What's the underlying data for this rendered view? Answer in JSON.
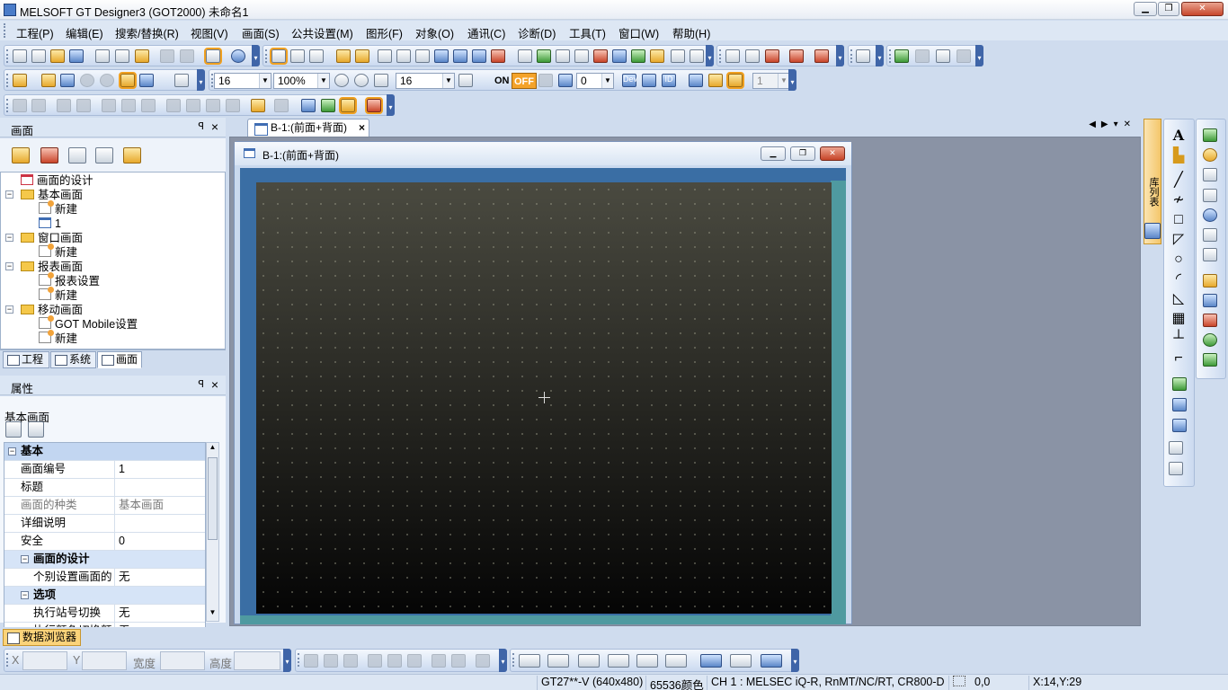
{
  "window": {
    "title": "MELSOFT GT Designer3 (GOT2000) 未命名1"
  },
  "menu": [
    "工程(P)",
    "编辑(E)",
    "搜索/替换(R)",
    "视图(V)",
    "画面(S)",
    "公共设置(M)",
    "图形(F)",
    "对象(O)",
    "通讯(C)",
    "诊断(D)",
    "工具(T)",
    "窗口(W)",
    "帮助(H)"
  ],
  "toolbar2": {
    "font_size": "16",
    "zoom": "100%",
    "grid_size": "16",
    "on_label": "ON",
    "off_label": "OFF",
    "state_value": "0",
    "dev_label": "Dev",
    "id_label": "ID",
    "layer_value": "1"
  },
  "screen_panel": {
    "title": "画面",
    "tree": [
      {
        "label": "画面的设计",
        "type": "design"
      },
      {
        "label": "基本画面",
        "type": "folder"
      },
      {
        "label": "新建",
        "type": "new"
      },
      {
        "label": "1",
        "type": "page"
      },
      {
        "label": "窗口画面",
        "type": "folder"
      },
      {
        "label": "新建",
        "type": "new"
      },
      {
        "label": "报表画面",
        "type": "folder"
      },
      {
        "label": "报表设置",
        "type": "setting"
      },
      {
        "label": "新建",
        "type": "new"
      },
      {
        "label": "移动画面",
        "type": "folder"
      },
      {
        "label": "GOT Mobile设置",
        "type": "setting"
      },
      {
        "label": "新建",
        "type": "new"
      }
    ],
    "tabs": [
      "工程",
      "系统",
      "画面"
    ],
    "active_tab": "画面"
  },
  "properties": {
    "title": "属性",
    "object_name": "基本画面",
    "rows": [
      {
        "kind": "cat",
        "k": "基本",
        "v": ""
      },
      {
        "kind": "row",
        "k": "画面编号",
        "v": "1"
      },
      {
        "kind": "row",
        "k": "标题",
        "v": ""
      },
      {
        "kind": "gray",
        "k": "画面的种类",
        "v": "基本画面"
      },
      {
        "kind": "row",
        "k": "详细说明",
        "v": ""
      },
      {
        "kind": "row",
        "k": "安全",
        "v": "0"
      },
      {
        "kind": "sub",
        "k": "画面的设计",
        "v": ""
      },
      {
        "kind": "row",
        "k": "个别设置画面的",
        "v": "无"
      },
      {
        "kind": "sub",
        "k": "选项",
        "v": ""
      },
      {
        "kind": "row",
        "k": "执行站号切换",
        "v": "无"
      },
      {
        "kind": "row",
        "k": "执行颜色切换颜",
        "v": "无"
      }
    ]
  },
  "document": {
    "tab_label": "B-1:(前面+背面)",
    "child_title": "B-1:(前面+背面)"
  },
  "right_panel": {
    "vertical_tab": "库列表"
  },
  "bottom": {
    "data_browser_tab": "数据浏览器",
    "x_label": "X",
    "y_label": "Y",
    "width_label": "宽度",
    "height_label": "高度"
  },
  "status": {
    "model": "GT27**-V (640x480)",
    "colors": "65536颜色",
    "channel": "CH 1 : MELSEC iQ-R, RnMT/NC/RT, CR800-D",
    "origin": "0,0",
    "cursor": "X:14,Y:29"
  },
  "colors": {
    "accent": "#3f65a8",
    "chrome": "#cfdcee",
    "canvas_frame": "#3a6ea4",
    "canvas_edge": "#4f9aa0"
  }
}
